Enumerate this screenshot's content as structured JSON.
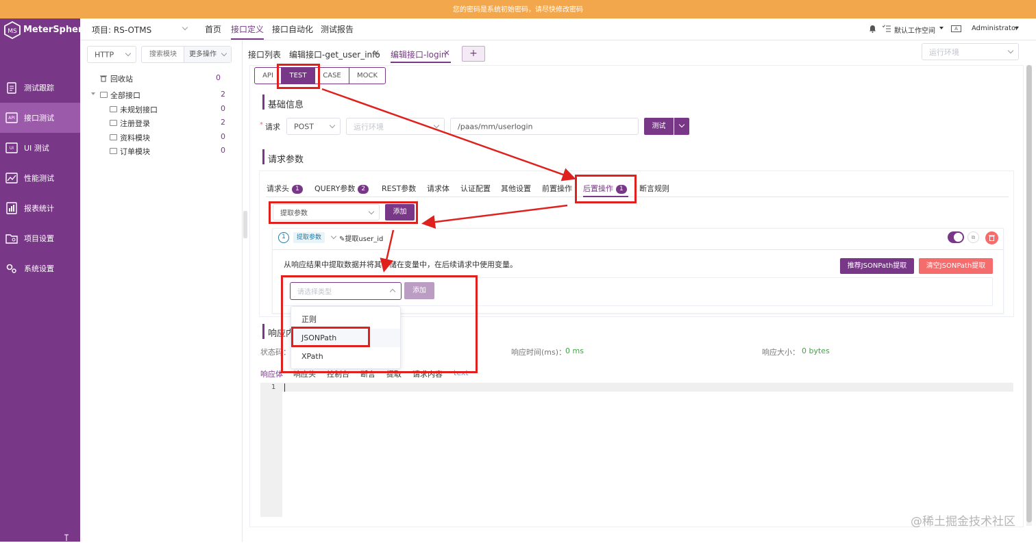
{
  "banner": {
    "text": "您的密码是系统初始密码，请尽快修改密码"
  },
  "app": {
    "name": "MeterSphere"
  },
  "sidebar": {
    "items": [
      {
        "label": "测试跟踪",
        "icon": "clipboard-icon"
      },
      {
        "label": "接口测试",
        "icon": "api-icon"
      },
      {
        "label": "UI 测试",
        "icon": "ui-icon"
      },
      {
        "label": "性能测试",
        "icon": "chart-icon"
      },
      {
        "label": "报表统计",
        "icon": "report-icon"
      },
      {
        "label": "项目设置",
        "icon": "folder-settings-icon"
      },
      {
        "label": "系统设置",
        "icon": "gear-icon"
      }
    ]
  },
  "header": {
    "project": "项目: RS-OTMS",
    "nav": [
      "首页",
      "接口定义",
      "接口自动化",
      "测试报告"
    ],
    "workspace": "默认工作空间",
    "user": "Administrator"
  },
  "left": {
    "protocol": "HTTP",
    "search_placeholder": "搜索模块",
    "more_ops": "更多操作",
    "tree": [
      {
        "label": "回收站",
        "count": "0"
      },
      {
        "label": "全部接口",
        "count": "2"
      },
      {
        "label": "未规划接口",
        "count": "0"
      },
      {
        "label": "注册登录",
        "count": "2"
      },
      {
        "label": "资料模块",
        "count": "0"
      },
      {
        "label": "订单模块",
        "count": "0"
      }
    ]
  },
  "tabs": {
    "items": [
      "接口列表",
      "编辑接口-get_user_info",
      "编辑接口-login"
    ],
    "add": "+",
    "env_placeholder": "运行环境"
  },
  "mode_tabs": [
    "API",
    "TEST",
    "CASE",
    "MOCK"
  ],
  "basic": {
    "title": "基础信息",
    "request_label": "请求",
    "required_mark": "*",
    "method": "POST",
    "env_placeholder": "运行环境",
    "url": "/paas/mm/userlogin",
    "test_button": "测试"
  },
  "params": {
    "title": "请求参数",
    "tabs": [
      {
        "label": "请求头",
        "badge": "1"
      },
      {
        "label": "QUERY参数",
        "badge": "2"
      },
      {
        "label": "REST参数"
      },
      {
        "label": "请求体"
      },
      {
        "label": "认证配置"
      },
      {
        "label": "其他设置"
      },
      {
        "label": "前置操作"
      },
      {
        "label": "后置操作",
        "badge": "1"
      },
      {
        "label": "断言规则"
      }
    ]
  },
  "post": {
    "select": "提取参数",
    "add": "添加",
    "item": {
      "index": "1",
      "tag": "提取参数",
      "name": "提取user_id"
    },
    "description": "从响应结果中提取数据并将其存储在变量中，在后续请求中使用变量。",
    "recommend_btn": "推荐JSONPath提取",
    "clear_btn": "清空JSONPath提取",
    "type_placeholder": "请选择类型",
    "add2": "添加",
    "options": [
      "正则",
      "JSONPath",
      "XPath"
    ]
  },
  "response": {
    "title": "响应内容",
    "status_label": "状态码：",
    "time_label": "响应时间(ms)：",
    "time_value": "0 ms",
    "size_label": "响应大小：",
    "size_value": "0 bytes",
    "tabs": [
      "响应体",
      "响应头",
      "控制台",
      "断言",
      "提取",
      "请求内容"
    ],
    "format": "text",
    "line": "1"
  },
  "watermark": "@稀土掘金技术社区",
  "colors": {
    "primary": "#783887",
    "banner": "#f2a74d",
    "annotation": "#e0201c",
    "danger": "#f56c6c",
    "success": "#43a047"
  }
}
